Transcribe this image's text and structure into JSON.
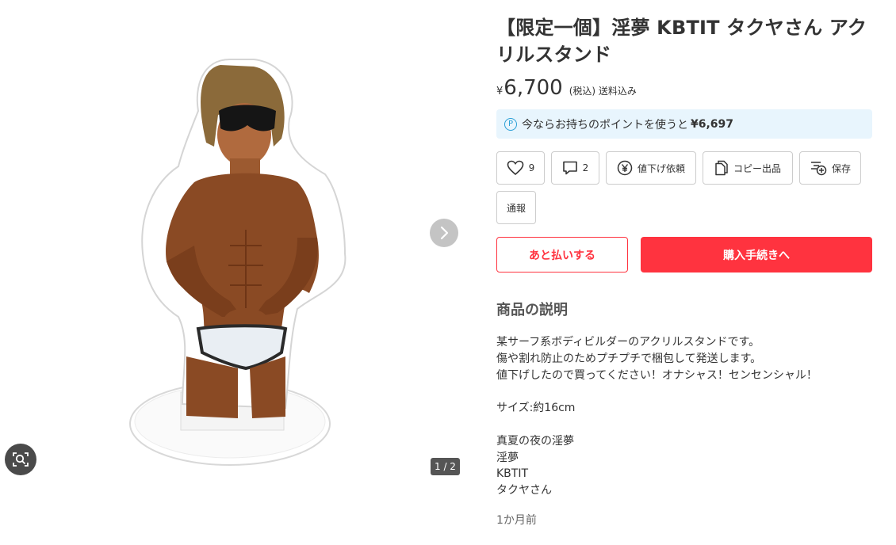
{
  "gallery": {
    "page_indicator": "1 / 2",
    "next_icon": "chevron-right-icon",
    "lens_icon": "image-search-icon"
  },
  "product": {
    "title": "【限定一個】淫夢 KBTIT タクヤさん アクリルスタンド",
    "currency": "¥",
    "price": "6,700",
    "price_note": "(税込) 送料込み",
    "points_icon": "P",
    "points_text": "今ならお持ちのポイントを使うと",
    "points_value": "¥6,697"
  },
  "actions": {
    "like_count": "9",
    "comment_count": "2",
    "price_request": "値下げ依頼",
    "copy_listing": "コピー出品",
    "save": "保存",
    "report": "通報"
  },
  "buy": {
    "later_pay": "あと払いする",
    "purchase": "購入手続きへ"
  },
  "description": {
    "heading": "商品の説明",
    "lines": [
      "某サーフ系ボディビルダーのアクリルスタンドです。",
      "傷や割れ防止のためプチプチで梱包して発送します。",
      "値下げしたので買ってください！オナシャス！センセンシャル！",
      "",
      "サイズ:約16cm",
      "",
      "真夏の夜の淫夢",
      "淫夢",
      "KBTIT",
      "タクヤさん"
    ],
    "timestamp": "1か月前"
  },
  "colors": {
    "accent_red": "#ff333f",
    "points_bg": "#e8f5fd",
    "points_blue": "#2a9fd6"
  }
}
